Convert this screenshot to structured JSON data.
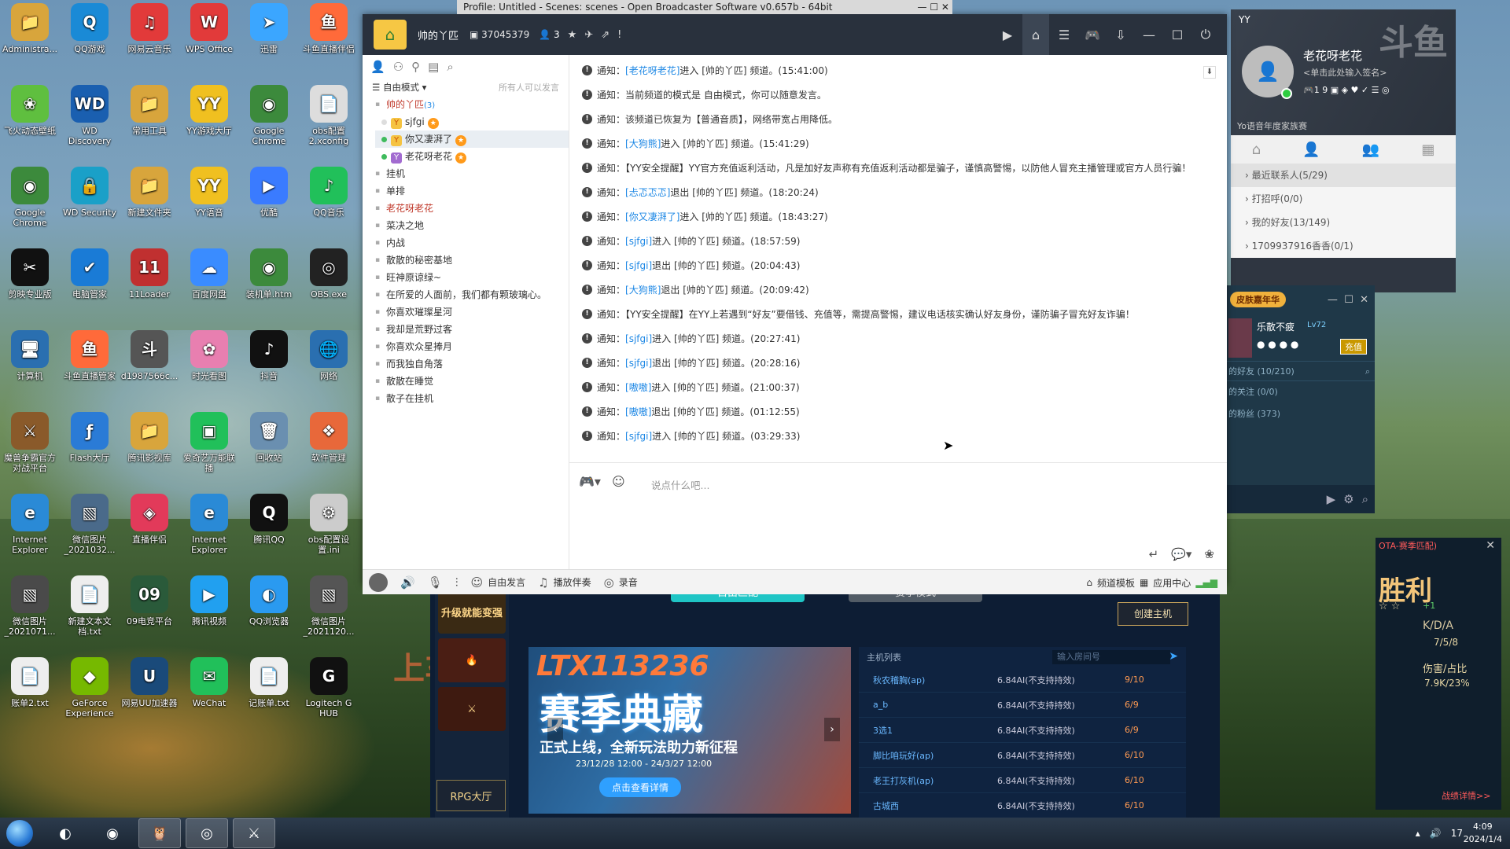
{
  "desktop": {
    "icons": [
      {
        "label": "Administra...",
        "glyph": "📁",
        "color": "#d8a53c"
      },
      {
        "label": "QQ游戏",
        "glyph": "Q",
        "color": "#1a8ad6"
      },
      {
        "label": "网易云音乐",
        "glyph": "♫",
        "color": "#e23a3a"
      },
      {
        "label": "WPS Office",
        "glyph": "W",
        "color": "#e23a3a"
      },
      {
        "label": "迅雷",
        "glyph": "➤",
        "color": "#3ba6ff"
      },
      {
        "label": "斗鱼直播伴侣",
        "glyph": "鱼",
        "color": "#ff6a3a"
      },
      {
        "label": "飞火动态壁纸",
        "glyph": "❀",
        "color": "#5fbf3f"
      },
      {
        "label": "WD Discovery",
        "glyph": "WD",
        "color": "#1a5fb0"
      },
      {
        "label": "常用工具",
        "glyph": "📁",
        "color": "#d8a53c"
      },
      {
        "label": "YY游戏大厅",
        "glyph": "YY",
        "color": "#f0c020"
      },
      {
        "label": "Google Chrome",
        "glyph": "◉",
        "color": "#3c8a3c"
      },
      {
        "label": "obs配置2.xconfig",
        "glyph": "📄",
        "color": "#dddddd"
      },
      {
        "label": "Google Chrome",
        "glyph": "◉",
        "color": "#3c8a3c"
      },
      {
        "label": "WD Security",
        "glyph": "🔒",
        "color": "#1aa0c8"
      },
      {
        "label": "新建文件夹",
        "glyph": "📁",
        "color": "#d8a53c"
      },
      {
        "label": "YY语音",
        "glyph": "YY",
        "color": "#f0c020"
      },
      {
        "label": "优酷",
        "glyph": "▶",
        "color": "#3a7bff"
      },
      {
        "label": "QQ音乐",
        "glyph": "♪",
        "color": "#21c05a"
      },
      {
        "label": "剪映专业版",
        "glyph": "✂",
        "color": "#111111"
      },
      {
        "label": "电脑管家",
        "glyph": "✔",
        "color": "#1a7bd6"
      },
      {
        "label": "11Loader",
        "glyph": "11",
        "color": "#c03030"
      },
      {
        "label": "百度网盘",
        "glyph": "☁",
        "color": "#3a8cff"
      },
      {
        "label": "装机单.htm",
        "glyph": "◉",
        "color": "#3c8a3c"
      },
      {
        "label": "OBS.exe",
        "glyph": "◎",
        "color": "#222222"
      },
      {
        "label": "计算机",
        "glyph": "🖥",
        "color": "#2a6fb0"
      },
      {
        "label": "斗鱼直播管家",
        "glyph": "鱼",
        "color": "#ff6a3a"
      },
      {
        "label": "d1987566c...",
        "glyph": "斗",
        "color": "#555555"
      },
      {
        "label": "时光看图",
        "glyph": "✿",
        "color": "#e87fb0"
      },
      {
        "label": "抖音",
        "glyph": "♪",
        "color": "#111111"
      },
      {
        "label": "网络",
        "glyph": "🌐",
        "color": "#2a6fb0"
      },
      {
        "label": "魔兽争霸官方对战平台",
        "glyph": "⚔",
        "color": "#8a5a2a"
      },
      {
        "label": "Flash大厅",
        "glyph": "ƒ",
        "color": "#2a7bd6"
      },
      {
        "label": "腾讯影视库",
        "glyph": "📁",
        "color": "#d8a53c"
      },
      {
        "label": "爱奇艺万能联播",
        "glyph": "▣",
        "color": "#21c05a"
      },
      {
        "label": "回收站",
        "glyph": "🗑",
        "color": "#6a8fb0"
      },
      {
        "label": "软件管理",
        "glyph": "❖",
        "color": "#e8683a"
      },
      {
        "label": "Internet Explorer",
        "glyph": "e",
        "color": "#2a8ad6"
      },
      {
        "label": "微信图片_2021032...",
        "glyph": "▧",
        "color": "#4a6a8a"
      },
      {
        "label": "直播伴侣",
        "glyph": "◈",
        "color": "#e23a5a"
      },
      {
        "label": "Internet Explorer",
        "glyph": "e",
        "color": "#2a8ad6"
      },
      {
        "label": "腾讯QQ",
        "glyph": "Q",
        "color": "#111111"
      },
      {
        "label": "obs配置设置.ini",
        "glyph": "⚙",
        "color": "#cccccc"
      },
      {
        "label": "微信图片_2021071...",
        "glyph": "▧",
        "color": "#4a4a4a"
      },
      {
        "label": "新建文本文档.txt",
        "glyph": "📄",
        "color": "#eeeeee"
      },
      {
        "label": "09电竞平台",
        "glyph": "09",
        "color": "#2a5a3a"
      },
      {
        "label": "腾讯视频",
        "glyph": "▶",
        "color": "#21a0f0"
      },
      {
        "label": "QQ浏览器",
        "glyph": "◐",
        "color": "#2a9af0"
      },
      {
        "label": "微信图片_2021120...",
        "glyph": "▧",
        "color": "#555555"
      },
      {
        "label": "账单2.txt",
        "glyph": "📄",
        "color": "#eeeeee"
      },
      {
        "label": "GeForce Experience",
        "glyph": "◆",
        "color": "#76b900"
      },
      {
        "label": "网易UU加速器",
        "glyph": "U",
        "color": "#1a4a7a"
      },
      {
        "label": "WeChat",
        "glyph": "✉",
        "color": "#21c05a"
      },
      {
        "label": "记账单.txt",
        "glyph": "📄",
        "color": "#eeeeee"
      },
      {
        "label": "Logitech G HUB",
        "glyph": "G",
        "color": "#111111"
      }
    ],
    "overlay_text": "上车"
  },
  "obs_title": "Profile: Untitled - Scenes: scenes - Open Broadcaster Software v0.657b - 64bit",
  "yy": {
    "channel_name": "帅的丫匹",
    "channel_id": "37045379",
    "online_count": "3",
    "mode_label": "自由模式",
    "mode_hint": "所有人可以发言",
    "tree_root": "帅的丫匹",
    "tree_root_count": "(3)",
    "users": [
      {
        "name": "sjfgi",
        "badge": "Y",
        "selected": false,
        "online": false
      },
      {
        "name": "你又凄湃了",
        "badge": "Y",
        "selected": true,
        "online": true
      },
      {
        "name": "老花呀老花",
        "badge": "Y",
        "selected": false,
        "online": true
      }
    ],
    "channels": [
      "挂机",
      "单排",
      "老花呀老花",
      "菜决之地",
      "内战",
      "散散的秘密基地",
      "旺神原谅绿~",
      "在所爱的人面前，我们都有颗玻璃心。",
      "你喜欢璀璨星河",
      "我却是荒野过客",
      "你喜欢众星捧月",
      "而我独自角落",
      "散散在睡觉",
      "散子在挂机"
    ],
    "messages": [
      {
        "pre": "通知：",
        "name": "[老花呀老花]",
        "post": " 进入 [帅的丫匹] 频道。(15:41:00)"
      },
      {
        "pre": "通知：当前频道的模式是 自由模式，你可以随意发言。",
        "name": "",
        "post": ""
      },
      {
        "pre": "通知：该频道已恢复为【普通音质】，网络带宽占用降低。",
        "name": "",
        "post": ""
      },
      {
        "pre": "通知：",
        "name": "[大狗熊]",
        "post": " 进入 [帅的丫匹] 频道。(15:41:29)"
      },
      {
        "pre": "通知：【YY安全提醒】YY官方充值返利活动，凡是加好友声称有充值返利活动都是骗子，谨慎高警惕，以防他人冒充主播管理或官方人员行骗！",
        "name": "",
        "post": ""
      },
      {
        "pre": "通知：",
        "name": "[忐忑忑忑]",
        "post": " 退出 [帅的丫匹] 频道。(18:20:24)"
      },
      {
        "pre": "通知：",
        "name": "[你又凄湃了]",
        "post": " 进入 [帅的丫匹] 频道。(18:43:27)"
      },
      {
        "pre": "通知：",
        "name": "[sjfgi]",
        "post": " 进入 [帅的丫匹] 频道。(18:57:59)"
      },
      {
        "pre": "通知：",
        "name": "[sjfgi]",
        "post": " 退出 [帅的丫匹] 频道。(20:04:43)"
      },
      {
        "pre": "通知：",
        "name": "[大狗熊]",
        "post": " 退出 [帅的丫匹] 频道。(20:09:42)"
      },
      {
        "pre": "通知：【YY安全提醒】在YY上若遇到“好友”要借钱、充值等，需提高警惕，建议电话核实确认好友身份，谨防骗子冒充好友诈骗！",
        "name": "",
        "post": ""
      },
      {
        "pre": "通知：",
        "name": "[sjfgi]",
        "post": " 进入 [帅的丫匹] 频道。(20:27:41)"
      },
      {
        "pre": "通知：",
        "name": "[sjfgi]",
        "post": " 退出 [帅的丫匹] 频道。(20:28:16)"
      },
      {
        "pre": "通知：",
        "name": "[嗷嗷]",
        "post": " 进入 [帅的丫匹] 频道。(21:00:37)"
      },
      {
        "pre": "通知：",
        "name": "[嗷嗷]",
        "post": " 退出 [帅的丫匹] 频道。(01:12:55)"
      },
      {
        "pre": "通知：",
        "name": "[sjfgi]",
        "post": " 进入 [帅的丫匹] 频道。(03:29:33)"
      }
    ],
    "input_placeholder": "说点什么吧...",
    "bottom": {
      "free_talk": "自由发言",
      "play_music": "播放伴奏",
      "record": "录音",
      "channel_template": "频道模板",
      "app_center": "应用中心"
    }
  },
  "yy_side": {
    "label": "YY",
    "watermark": "斗鱼",
    "username": "老花呀老花",
    "signature": "<单击此处输入签名>",
    "icon_counts": "1  9",
    "year_text": "Yo语音年度家族赛",
    "groups": [
      "最近联系人(5/29)",
      "打招呼(0/0)",
      "我的好友(13/149)",
      "1709937916香香(0/1)"
    ]
  },
  "skin_panel": {
    "carnival": "皮肤嘉年华",
    "username": "乐散不疲",
    "level": "Lv72",
    "charge": "充值",
    "friends": "的好友 (10/210)",
    "follows": "的关注 (0/0)",
    "fans": "的粉丝 (373)"
  },
  "game_stat": {
    "header": "OTA-赛季匹配)",
    "result": "胜利",
    "plus": "+1",
    "kda_label": "K/D/A",
    "kda": "7/5/8",
    "dmg_label": "伤害/占比",
    "dmg": "7.9K/23%",
    "detail": "战绩详情>>"
  },
  "lobby": {
    "free_match": "自由匹配",
    "ranked": "赛季模式",
    "create": "创建主机",
    "upgrade": "升级就能变强",
    "rpg": "RPG大厅",
    "banner_code": "LTX113236",
    "banner_title": "赛季典藏",
    "banner_sub": "正式上线，全新玩法助力新征程",
    "banner_dates": "23/12/28 12:00 - 24/3/27 12:00",
    "banner_cta": "点击查看详情",
    "host_list": "主机列表",
    "room_placeholder": "输入房间号",
    "hosts": [
      {
        "name": "秋农稽胸(ap)",
        "ver": "6.84AI(不支持持效)",
        "count": "9/10"
      },
      {
        "name": "a_b",
        "ver": "6.84AI(不支持持效)",
        "count": "6/9"
      },
      {
        "name": "3选1",
        "ver": "6.84AI(不支持持效)",
        "count": "6/9"
      },
      {
        "name": "脚比咱玩好(ap)",
        "ver": "6.84AI(不支持持效)",
        "count": "6/10"
      },
      {
        "name": "老王打灰机(ap)",
        "ver": "6.84AI(不支持持效)",
        "count": "6/10"
      },
      {
        "name": "古城西",
        "ver": "6.84AI(不支持持效)",
        "count": "6/10"
      }
    ]
  },
  "taskbar": {
    "time": "4:09",
    "date": "2024/1/4",
    "tray_num": "17"
  }
}
